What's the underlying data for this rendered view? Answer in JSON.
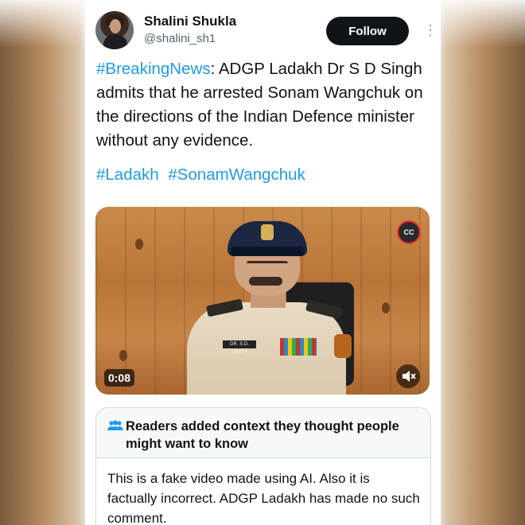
{
  "author": {
    "name": "Shalini Shukla",
    "handle": "@shalini_sh1",
    "follow_label": "Follow",
    "avatar_icon": "profile-avatar"
  },
  "tweet": {
    "hashtag_lead": "#BreakingNews",
    "text": ": ADGP Ladakh Dr S D Singh admits that he arrested Sonam Wangchuk on the directions of the Indian Defence minister without any evidence.",
    "tags": [
      "#Ladakh",
      "#SonamWangchuk"
    ]
  },
  "video": {
    "timestamp": "0:08",
    "cc_label": "CC",
    "nameplate": "DR. S.D. SINGH",
    "mute_icon": "muted-speaker-icon"
  },
  "community_note": {
    "title": "Readers added context they thought people might want to know",
    "body": "This is a fake video made using AI. Also it is factually incorrect. ADGP Ladakh has made no such comment.",
    "icon": "people-icon"
  },
  "colors": {
    "link": "#1d9bf0",
    "text": "#0f1419",
    "muted": "#536471",
    "button_bg": "#0f1419"
  }
}
